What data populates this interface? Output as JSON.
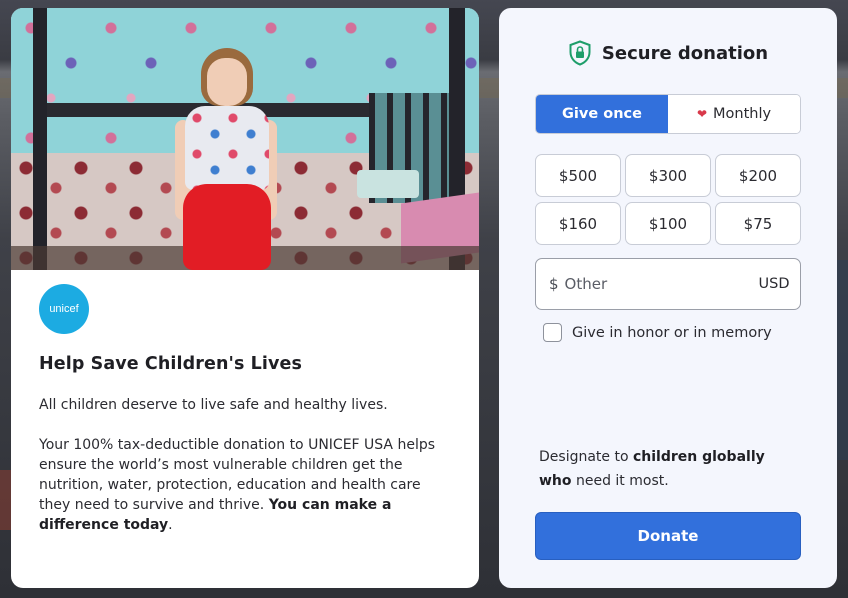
{
  "story": {
    "logo_text": "unicef",
    "title": "Help Save Children's Lives",
    "lead": "All children deserve to live safe and healthy lives.",
    "body_text": "Your 100% tax-deductible donation to UNICEF USA helps ensure the world’s most vulnerable children get the nutrition, water, protection, education and health care they need to survive and thrive. ",
    "body_bold": "You can make a difference today",
    "body_end": "."
  },
  "donation": {
    "header": {
      "icon": "shield-lock-icon",
      "title": "Secure donation"
    },
    "frequency": {
      "options": [
        {
          "label": "Give once",
          "selected": true
        },
        {
          "label": "Monthly",
          "icon": "heart-icon",
          "selected": false
        }
      ]
    },
    "amounts": [
      "$500",
      "$300",
      "$200",
      "$160",
      "$100",
      "$75"
    ],
    "other": {
      "prefix": "$",
      "placeholder": "Other",
      "value": "",
      "currency": "USD"
    },
    "honor": {
      "label": "Give in honor or in memory",
      "checked": false
    },
    "designate": {
      "prefix": "Designate to ",
      "emphasis": "children globally who",
      "suffix": " need it most."
    },
    "donate_label": "Donate"
  },
  "colors": {
    "accent": "#3270dc",
    "unicef_blue": "#1cabe2",
    "shield_green": "#1e9e6a",
    "heart_red": "#d8394a"
  }
}
